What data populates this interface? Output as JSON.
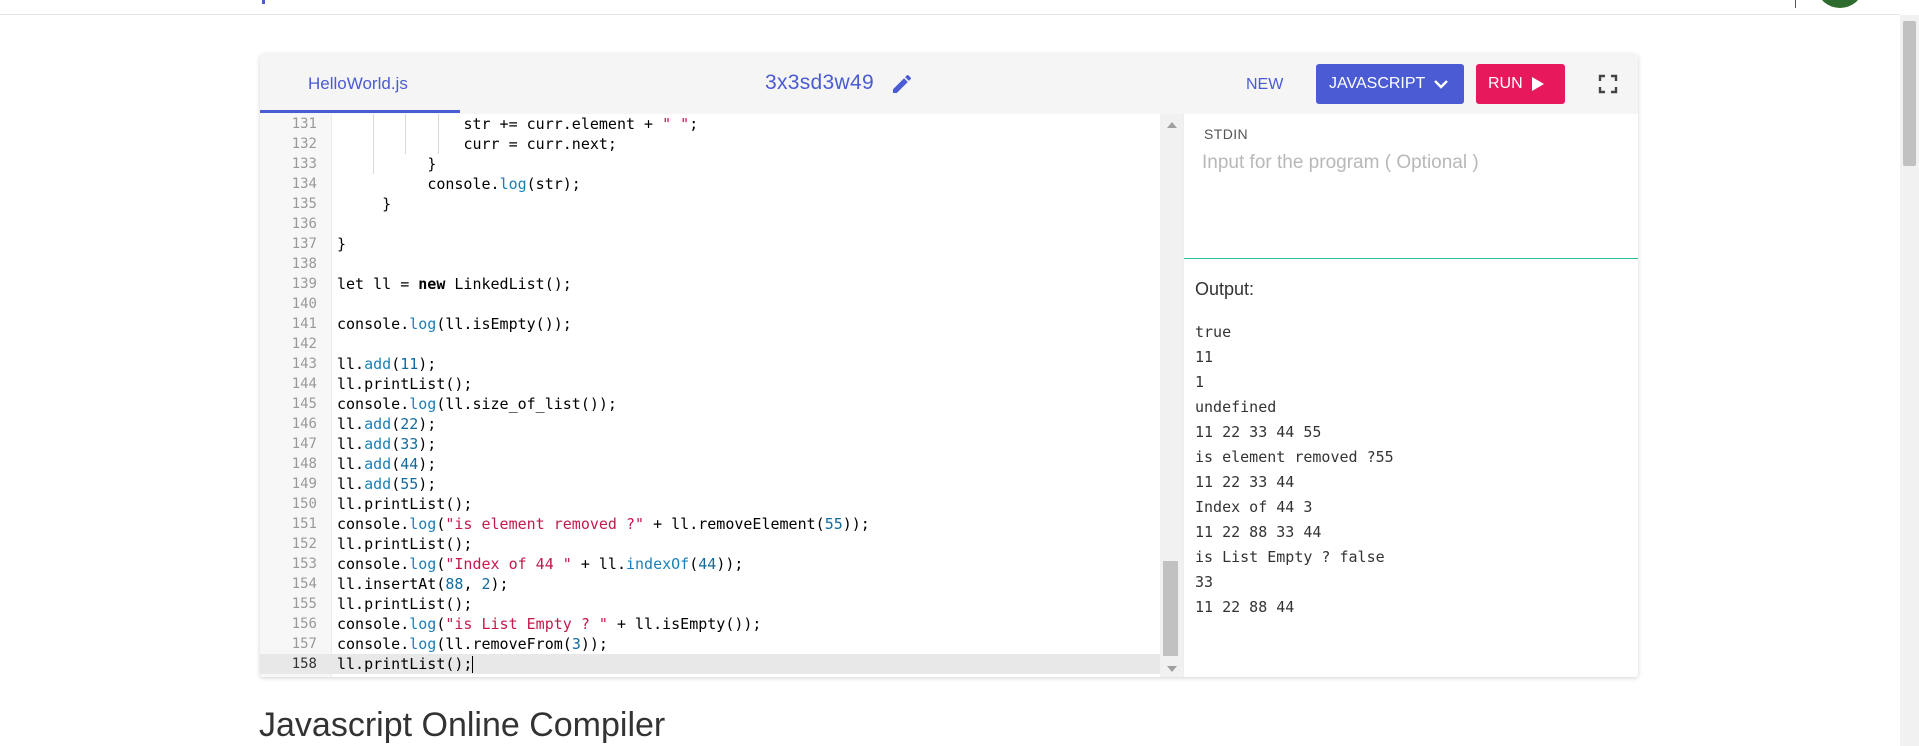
{
  "toolbar": {
    "file_tab": "HelloWorld.js",
    "project_name": "3x3sd3w49",
    "new_label": "NEW",
    "language_label": "JAVASCRIPT",
    "run_label": "RUN"
  },
  "editor": {
    "lines": [
      {
        "n": "131",
        "indent": "              ",
        "tokens": [
          {
            "t": "str += curr.element + ",
            "c": ""
          },
          {
            "t": "\" \"",
            "c": "s"
          },
          {
            "t": ";",
            "c": ""
          }
        ]
      },
      {
        "n": "132",
        "indent": "              ",
        "tokens": [
          {
            "t": "curr = curr.next;",
            "c": ""
          }
        ]
      },
      {
        "n": "133",
        "indent": "          ",
        "tokens": [
          {
            "t": "}",
            "c": ""
          }
        ]
      },
      {
        "n": "134",
        "indent": "          ",
        "tokens": [
          {
            "t": "console.",
            "c": ""
          },
          {
            "t": "log",
            "c": "m"
          },
          {
            "t": "(str);",
            "c": ""
          }
        ]
      },
      {
        "n": "135",
        "indent": "     ",
        "tokens": [
          {
            "t": "}",
            "c": ""
          }
        ]
      },
      {
        "n": "136",
        "indent": "",
        "tokens": []
      },
      {
        "n": "137",
        "indent": "",
        "tokens": [
          {
            "t": "}",
            "c": ""
          }
        ]
      },
      {
        "n": "138",
        "indent": "",
        "tokens": []
      },
      {
        "n": "139",
        "indent": "",
        "tokens": [
          {
            "t": "let ll = ",
            "c": ""
          },
          {
            "t": "new",
            "c": "k"
          },
          {
            "t": " LinkedList();",
            "c": ""
          }
        ]
      },
      {
        "n": "140",
        "indent": "",
        "tokens": []
      },
      {
        "n": "141",
        "indent": "",
        "tokens": [
          {
            "t": "console.",
            "c": ""
          },
          {
            "t": "log",
            "c": "m"
          },
          {
            "t": "(ll.isEmpty());",
            "c": ""
          }
        ]
      },
      {
        "n": "142",
        "indent": "",
        "tokens": []
      },
      {
        "n": "143",
        "indent": "",
        "tokens": [
          {
            "t": "ll.",
            "c": ""
          },
          {
            "t": "add",
            "c": "m"
          },
          {
            "t": "(",
            "c": ""
          },
          {
            "t": "11",
            "c": "n"
          },
          {
            "t": ");",
            "c": ""
          }
        ]
      },
      {
        "n": "144",
        "indent": "",
        "tokens": [
          {
            "t": "ll.printList();",
            "c": ""
          }
        ]
      },
      {
        "n": "145",
        "indent": "",
        "tokens": [
          {
            "t": "console.",
            "c": ""
          },
          {
            "t": "log",
            "c": "m"
          },
          {
            "t": "(ll.size_of_list());",
            "c": ""
          }
        ]
      },
      {
        "n": "146",
        "indent": "",
        "tokens": [
          {
            "t": "ll.",
            "c": ""
          },
          {
            "t": "add",
            "c": "m"
          },
          {
            "t": "(",
            "c": ""
          },
          {
            "t": "22",
            "c": "n"
          },
          {
            "t": ");",
            "c": ""
          }
        ]
      },
      {
        "n": "147",
        "indent": "",
        "tokens": [
          {
            "t": "ll.",
            "c": ""
          },
          {
            "t": "add",
            "c": "m"
          },
          {
            "t": "(",
            "c": ""
          },
          {
            "t": "33",
            "c": "n"
          },
          {
            "t": ");",
            "c": ""
          }
        ]
      },
      {
        "n": "148",
        "indent": "",
        "tokens": [
          {
            "t": "ll.",
            "c": ""
          },
          {
            "t": "add",
            "c": "m"
          },
          {
            "t": "(",
            "c": ""
          },
          {
            "t": "44",
            "c": "n"
          },
          {
            "t": ");",
            "c": ""
          }
        ]
      },
      {
        "n": "149",
        "indent": "",
        "tokens": [
          {
            "t": "ll.",
            "c": ""
          },
          {
            "t": "add",
            "c": "m"
          },
          {
            "t": "(",
            "c": ""
          },
          {
            "t": "55",
            "c": "n"
          },
          {
            "t": ");",
            "c": ""
          }
        ]
      },
      {
        "n": "150",
        "indent": "",
        "tokens": [
          {
            "t": "ll.printList();",
            "c": ""
          }
        ]
      },
      {
        "n": "151",
        "indent": "",
        "tokens": [
          {
            "t": "console.",
            "c": ""
          },
          {
            "t": "log",
            "c": "m"
          },
          {
            "t": "(",
            "c": ""
          },
          {
            "t": "\"is element removed ?\"",
            "c": "s"
          },
          {
            "t": " + ll.removeElement(",
            "c": ""
          },
          {
            "t": "55",
            "c": "n"
          },
          {
            "t": "));",
            "c": ""
          }
        ]
      },
      {
        "n": "152",
        "indent": "",
        "tokens": [
          {
            "t": "ll.printList();",
            "c": ""
          }
        ]
      },
      {
        "n": "153",
        "indent": "",
        "tokens": [
          {
            "t": "console.",
            "c": ""
          },
          {
            "t": "log",
            "c": "m"
          },
          {
            "t": "(",
            "c": ""
          },
          {
            "t": "\"Index of 44 \"",
            "c": "s"
          },
          {
            "t": " + ll.",
            "c": ""
          },
          {
            "t": "indexOf",
            "c": "m"
          },
          {
            "t": "(",
            "c": ""
          },
          {
            "t": "44",
            "c": "n"
          },
          {
            "t": "));",
            "c": ""
          }
        ]
      },
      {
        "n": "154",
        "indent": "",
        "tokens": [
          {
            "t": "ll.insertAt(",
            "c": ""
          },
          {
            "t": "88",
            "c": "n"
          },
          {
            "t": ", ",
            "c": ""
          },
          {
            "t": "2",
            "c": "n"
          },
          {
            "t": ");",
            "c": ""
          }
        ]
      },
      {
        "n": "155",
        "indent": "",
        "tokens": [
          {
            "t": "ll.printList();",
            "c": ""
          }
        ]
      },
      {
        "n": "156",
        "indent": "",
        "tokens": [
          {
            "t": "console.",
            "c": ""
          },
          {
            "t": "log",
            "c": "m"
          },
          {
            "t": "(",
            "c": ""
          },
          {
            "t": "\"is List Empty ? \"",
            "c": "s"
          },
          {
            "t": " + ll.isEmpty());",
            "c": ""
          }
        ]
      },
      {
        "n": "157",
        "indent": "",
        "tokens": [
          {
            "t": "console.",
            "c": ""
          },
          {
            "t": "log",
            "c": "m"
          },
          {
            "t": "(ll.removeFrom(",
            "c": ""
          },
          {
            "t": "3",
            "c": "n"
          },
          {
            "t": "));",
            "c": ""
          }
        ]
      },
      {
        "n": "158",
        "indent": "",
        "tokens": [
          {
            "t": "ll.printList();",
            "c": ""
          }
        ],
        "active": true
      }
    ]
  },
  "stdin": {
    "label": "STDIN",
    "placeholder": "Input for the program ( Optional )"
  },
  "output": {
    "label": "Output:",
    "lines": [
      "true",
      "11",
      "1",
      "undefined",
      "11 22 33 44 55",
      "is element removed ?55",
      "11 22 33 44",
      "Index of 44 3",
      "11 22 88 33 44",
      "is List Empty ? false",
      "33",
      "11 22 88 44"
    ]
  },
  "page": {
    "heading": "Javascript Online Compiler"
  },
  "colors": {
    "accent": "#4a5bd4",
    "run": "#e8185d",
    "divider": "#2bbf9b"
  },
  "icons": {
    "edit": "pencil-icon",
    "language_dropdown": "chevron-down-icon",
    "run": "play-icon",
    "fullscreen": "fullscreen-icon"
  }
}
